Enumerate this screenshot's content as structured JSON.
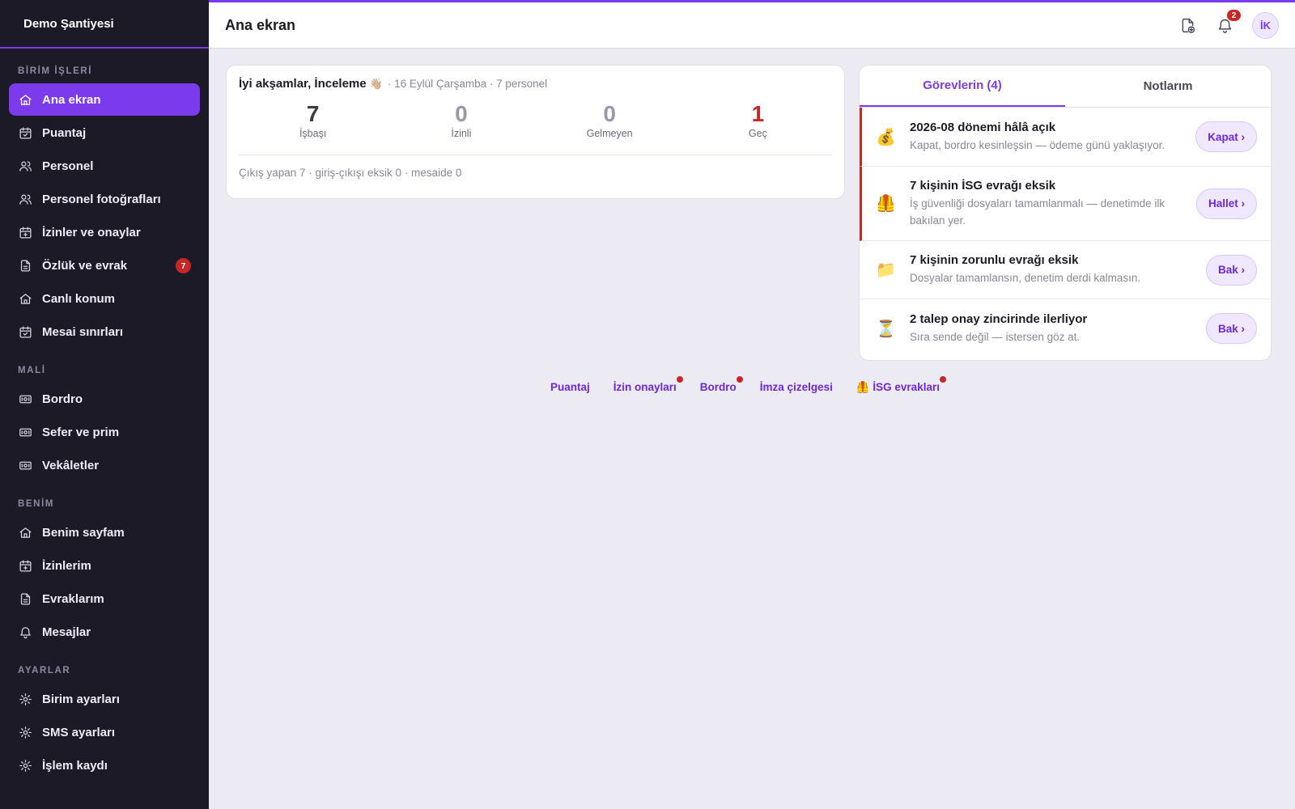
{
  "sidebar": {
    "brand": "Demo Şantiyesi",
    "sections": [
      {
        "title": "BİRİM İŞLERİ",
        "items": [
          {
            "label": "Ana ekran",
            "icon": "home-icon",
            "active": true
          },
          {
            "label": "Puantaj",
            "icon": "calendar-check-icon"
          },
          {
            "label": "Personel",
            "icon": "users-icon"
          },
          {
            "label": "Personel fotoğrafları",
            "icon": "users-icon"
          },
          {
            "label": "İzinler ve onaylar",
            "icon": "calendar-plus-icon"
          },
          {
            "label": "Özlük ve evrak",
            "icon": "document-icon",
            "badge": "7"
          },
          {
            "label": "Canlı konum",
            "icon": "home-icon"
          },
          {
            "label": "Mesai sınırları",
            "icon": "calendar-check-icon"
          }
        ]
      },
      {
        "title": "MALİ",
        "items": [
          {
            "label": "Bordro",
            "icon": "money-icon"
          },
          {
            "label": "Sefer ve prim",
            "icon": "money-icon"
          },
          {
            "label": "Vekâletler",
            "icon": "money-icon"
          }
        ]
      },
      {
        "title": "BENİM",
        "items": [
          {
            "label": "Benim sayfam",
            "icon": "home-icon"
          },
          {
            "label": "İzinlerim",
            "icon": "calendar-plus-icon"
          },
          {
            "label": "Evraklarım",
            "icon": "document-icon"
          },
          {
            "label": "Mesajlar",
            "icon": "bell-icon"
          }
        ]
      },
      {
        "title": "AYARLAR",
        "items": [
          {
            "label": "Birim ayarları",
            "icon": "gear-icon"
          },
          {
            "label": "SMS ayarları",
            "icon": "gear-icon"
          },
          {
            "label": "İşlem kaydı",
            "icon": "gear-icon"
          }
        ]
      }
    ]
  },
  "header": {
    "title": "Ana ekran",
    "notification_count": "2",
    "avatar_initials": "İK"
  },
  "summary": {
    "greeting": "İyi akşamlar, İnceleme",
    "greeting_emoji": "👋🏼",
    "meta": "· 16 Eylül Çarşamba · 7 personel",
    "stats": [
      {
        "value": "7",
        "label": "İşbaşı",
        "tone": "normal"
      },
      {
        "value": "0",
        "label": "İzinli",
        "tone": "muted"
      },
      {
        "value": "0",
        "label": "Gelmeyen",
        "tone": "muted"
      },
      {
        "value": "1",
        "label": "Geç",
        "tone": "late"
      }
    ],
    "footer": "Çıkış yapan 7 · giriş-çıkışı eksik 0 · mesaide 0"
  },
  "tasks_panel": {
    "tabs": [
      {
        "label": "Görevlerin (4)",
        "active": true
      },
      {
        "label": "Notlarım",
        "active": false
      }
    ],
    "tasks": [
      {
        "emoji": "💰",
        "title": "2026-08 dönemi hâlâ açık",
        "desc": "Kapat, bordro kesinleşsin — ödeme günü yaklaşıyor.",
        "button": "Kapat ›",
        "urgent": true
      },
      {
        "emoji": "🦺",
        "title": "7 kişinin İSG evrağı eksik",
        "desc": "İş güvenliği dosyaları tamamlanmalı — denetimde ilk bakılan yer.",
        "button": "Hallet ›",
        "urgent": true
      },
      {
        "emoji": "📁",
        "title": "7 kişinin zorunlu evrağı eksik",
        "desc": "Dosyalar tamamlansın, denetim derdi kalmasın.",
        "button": "Bak ›",
        "urgent": false
      },
      {
        "emoji": "⏳",
        "title": "2 talep onay zincirinde ilerliyor",
        "desc": "Sıra sende değil — istersen göz at.",
        "button": "Bak ›",
        "urgent": false
      }
    ]
  },
  "quick_links": [
    {
      "label": "Puantaj",
      "dot": false
    },
    {
      "label": "İzin onayları",
      "dot": true
    },
    {
      "label": "Bordro",
      "dot": true
    },
    {
      "label": "İmza çizelgesi",
      "dot": false
    },
    {
      "label": "🦺 İSG evrakları",
      "dot": true
    }
  ],
  "colors": {
    "accent": "#7c3aed",
    "sidebar_bg": "#1c1a27",
    "alert": "#c62828",
    "page_bg": "#eceaf3"
  }
}
